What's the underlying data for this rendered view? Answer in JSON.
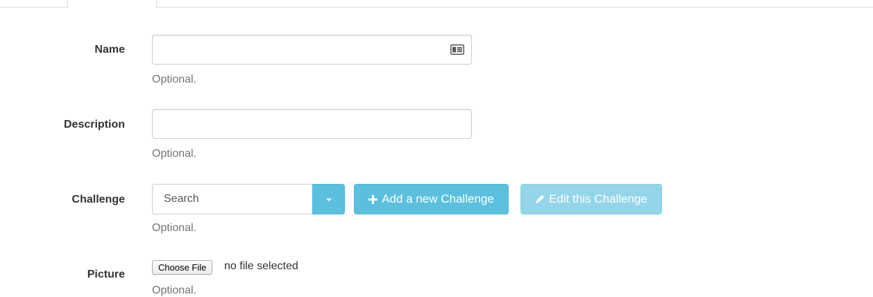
{
  "form": {
    "name": {
      "label": "Name",
      "value": "",
      "help": "Optional.",
      "icon": "id-card-icon"
    },
    "description": {
      "label": "Description",
      "value": "",
      "help": "Optional."
    },
    "challenge": {
      "label": "Challenge",
      "search_placeholder": "Search",
      "add_label": "Add a new Challenge",
      "add_icon": "plus-icon",
      "edit_label": "Edit this Challenge",
      "edit_icon": "pencil-icon",
      "edit_disabled": true,
      "help": "Optional."
    },
    "picture": {
      "label": "Picture",
      "choose_label": "Choose File",
      "status": "no file selected",
      "help": "Optional."
    }
  },
  "colors": {
    "info": "#5bc0de",
    "info_border": "#46b8da",
    "label_text": "#333333",
    "help_text": "#737373",
    "input_border": "#cccccc"
  }
}
